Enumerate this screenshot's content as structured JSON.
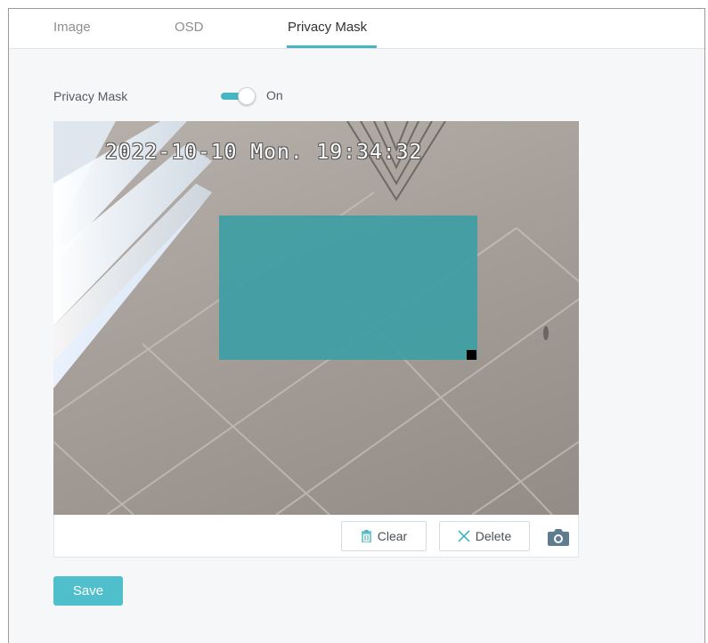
{
  "tabs": [
    {
      "label": "Image",
      "active": false
    },
    {
      "label": "OSD",
      "active": false
    },
    {
      "label": "Privacy Mask",
      "active": true
    }
  ],
  "privacy_mask": {
    "label": "Privacy Mask",
    "toggle_on": true,
    "toggle_state_text": "On"
  },
  "video": {
    "osd_timestamp": "2022-10-10 Mon. 19:34:32"
  },
  "toolbar": {
    "clear_label": "Clear",
    "delete_label": "Delete",
    "clear_icon": "trash-icon",
    "delete_icon": "close-icon",
    "snapshot_icon": "camera-icon"
  },
  "actions": {
    "save_label": "Save"
  },
  "colors": {
    "accent": "#45b6c2",
    "mask": "#3d9ea4",
    "save_button": "#4fc0cb"
  }
}
